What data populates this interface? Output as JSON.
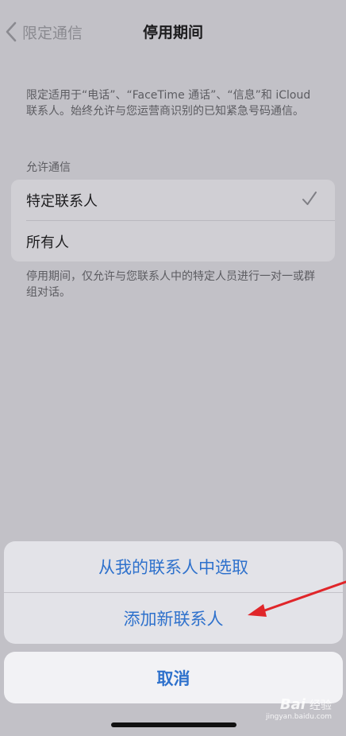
{
  "nav": {
    "back_label": "限定通信",
    "title": "停用期间"
  },
  "description": "限定适用于“电话”、“FaceTime 通话”、“信息”和 iCloud 联系人。始终允许与您运营商识别的已知紧急号码通信。",
  "allow_section": {
    "header": "允许通信",
    "options": [
      {
        "label": "特定联系人",
        "selected": true
      },
      {
        "label": "所有人",
        "selected": false
      }
    ],
    "footer": "停用期间，仅允许与您联系人中的特定人员进行一对一或群组对话。"
  },
  "action_sheet": {
    "choose_from_contacts": "从我的联系人中选取",
    "add_new_contact": "添加新联系人",
    "cancel": "取消"
  },
  "watermark": {
    "logo_left": "Bai",
    "logo_right": "经验",
    "url": "jingyan.baidu.com"
  },
  "colors": {
    "accent": "#2e71cc",
    "annotation_arrow": "#e0262a"
  }
}
